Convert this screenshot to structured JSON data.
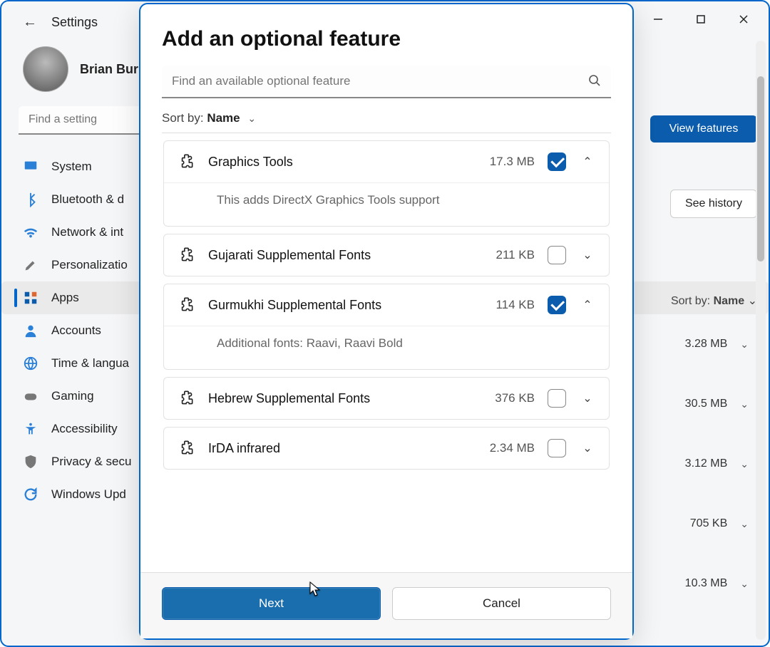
{
  "window": {
    "back_arrow": "←",
    "title": "Settings",
    "user_name": "Brian Bur",
    "search_placeholder": "Find a setting"
  },
  "nav": {
    "items": [
      {
        "id": "system",
        "label": "System",
        "icon": "monitor",
        "color": "#2a7fd6"
      },
      {
        "id": "bluetooth",
        "label": "Bluetooth & d",
        "icon": "bluetooth",
        "color": "#2a7fd6"
      },
      {
        "id": "network",
        "label": "Network & int",
        "icon": "wifi",
        "color": "#2a7fd6"
      },
      {
        "id": "personalization",
        "label": "Personalizatio",
        "icon": "brush",
        "color": "#777"
      },
      {
        "id": "apps",
        "label": "Apps",
        "icon": "apps",
        "color": "#0b5cad",
        "active": true
      },
      {
        "id": "accounts",
        "label": "Accounts",
        "icon": "person",
        "color": "#2a7fd6"
      },
      {
        "id": "time",
        "label": "Time & langua",
        "icon": "globe",
        "color": "#2a7fd6"
      },
      {
        "id": "gaming",
        "label": "Gaming",
        "icon": "gamepad",
        "color": "#777"
      },
      {
        "id": "accessibility",
        "label": "Accessibility",
        "icon": "accessibility",
        "color": "#2a7fd6"
      },
      {
        "id": "privacy",
        "label": "Privacy & secu",
        "icon": "shield",
        "color": "#777"
      },
      {
        "id": "update",
        "label": "Windows Upd",
        "icon": "refresh",
        "color": "#2a7fd6"
      }
    ]
  },
  "bg_panel": {
    "view_features": "View features",
    "see_history": "See history",
    "sort_prefix": "Sort by:",
    "sort_value": "Name",
    "list": [
      {
        "size": "3.28 MB"
      },
      {
        "size": "30.5 MB"
      },
      {
        "size": "3.12 MB"
      },
      {
        "size": "705 KB"
      },
      {
        "size": "10.3 MB"
      }
    ]
  },
  "modal": {
    "title": "Add an optional feature",
    "search_placeholder": "Find an available optional feature",
    "sort_prefix": "Sort by:",
    "sort_value": "Name",
    "features": [
      {
        "name": "Graphics Tools",
        "size": "17.3 MB",
        "checked": true,
        "expanded": true,
        "desc": "This adds DirectX Graphics Tools support"
      },
      {
        "name": "Gujarati Supplemental Fonts",
        "size": "211 KB",
        "checked": false,
        "expanded": false
      },
      {
        "name": "Gurmukhi Supplemental Fonts",
        "size": "114 KB",
        "checked": true,
        "expanded": true,
        "desc": "Additional fonts: Raavi, Raavi Bold"
      },
      {
        "name": "Hebrew Supplemental Fonts",
        "size": "376 KB",
        "checked": false,
        "expanded": false
      },
      {
        "name": "IrDA infrared",
        "size": "2.34 MB",
        "checked": false,
        "expanded": false
      }
    ],
    "next": "Next",
    "cancel": "Cancel"
  }
}
